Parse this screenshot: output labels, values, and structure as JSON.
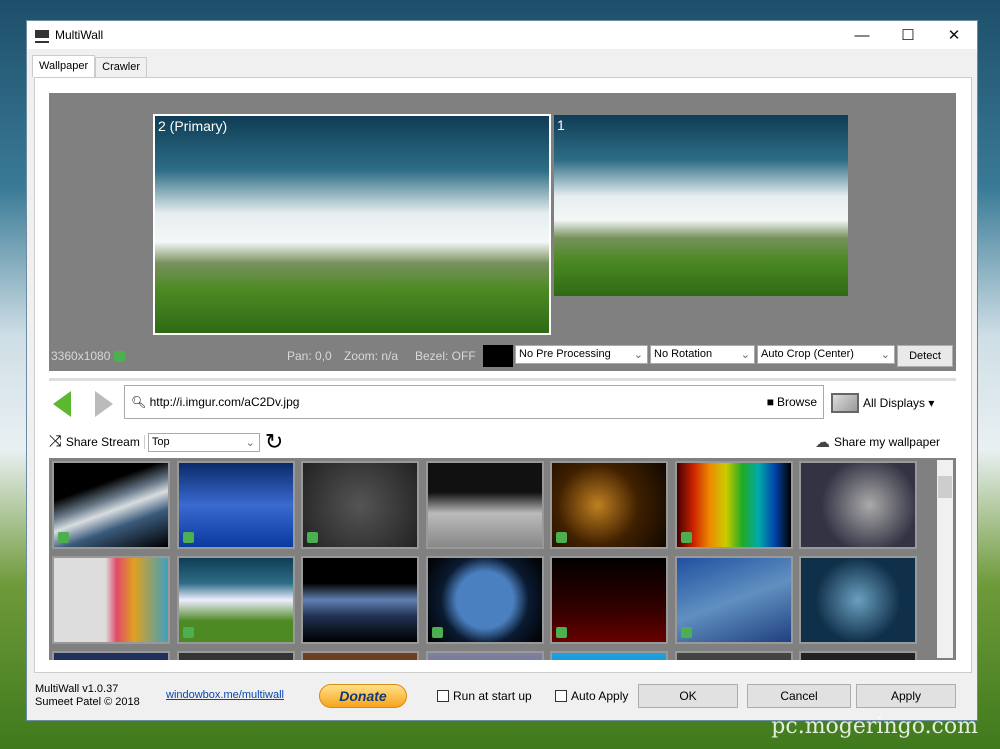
{
  "window": {
    "title": "MultiWall",
    "minimize": "—",
    "maximize": "☐",
    "close": "✕"
  },
  "tabs": [
    {
      "label": "Wallpaper",
      "active": true
    },
    {
      "label": "Crawler",
      "active": false
    }
  ],
  "preview": {
    "monitors": [
      {
        "label": "2 (Primary)"
      },
      {
        "label": "1"
      }
    ],
    "resolution": "3360x1080",
    "pan": "Pan: 0,0",
    "zoom": "Zoom: n/a",
    "bezel": "Bezel: OFF",
    "bg_color": "#000000",
    "pre_processing": "No Pre Processing",
    "rotation": "No Rotation",
    "crop": "Auto Crop (Center)",
    "detect": "Detect"
  },
  "url_bar": {
    "value": "http://i.imgur.com/aC2Dv.jpg",
    "browse": "Browse",
    "displays": "All Displays ▾"
  },
  "stream": {
    "share_stream": "Share Stream",
    "sort": "Top",
    "share_wallpaper": "Share my wallpaper"
  },
  "thumbnails": [
    {
      "bg": "linear-gradient(160deg,#000 30%,#6a7a8a 45%,#d8dde0 55%,#3a5a7a 70%,#000)",
      "liked": true
    },
    {
      "bg": "linear-gradient(180deg,#0a2a6a,#3a6ad0 50%,#0a3aa0)",
      "liked": true
    },
    {
      "bg": "radial-gradient(circle,#555,#222)",
      "liked": true
    },
    {
      "bg": "linear-gradient(180deg,#111 35%,#bbb 60%,#888)",
      "liked": false
    },
    {
      "bg": "radial-gradient(circle at 40% 50%,#c08020,#402000 50%,#100800)",
      "liked": true
    },
    {
      "bg": "linear-gradient(90deg,#400,#c20,#e80,#cc0,#2a2,#0aa,#04a,#000)",
      "liked": true
    },
    {
      "bg": "radial-gradient(circle at 60% 50%,#aaa,#334 60%)",
      "liked": false
    },
    {
      "bg": "linear-gradient(90deg,#ddd 45%,#e04a6a 55%,#e0a020 70%,#40a0c0)",
      "liked": false
    },
    {
      "bg": "linear-gradient(180deg,#0f3d55,#2d6d86 30%,#eef 50%,#4d8a24 75%)",
      "liked": true
    },
    {
      "bg": "linear-gradient(180deg,#000 30%,#6080b0 50%,#203050 70%,#000)",
      "liked": false
    },
    {
      "bg": "radial-gradient(circle,#4a80c0 40%,#0a1a30 62%,#000)",
      "liked": true
    },
    {
      "bg": "linear-gradient(180deg,#000,#300 60%,#600)",
      "liked": true
    },
    {
      "bg": "linear-gradient(160deg,#2050a0,#6090c0 50%,#204080)",
      "liked": true
    },
    {
      "bg": "radial-gradient(circle at 50% 50%,#6aa0c0,#10304a 60%)",
      "liked": false
    },
    {
      "bg": "linear-gradient(#203060,#101830)",
      "liked": false
    },
    {
      "bg": "linear-gradient(#333,#555)",
      "liked": false
    },
    {
      "bg": "linear-gradient(#704020,#302010)",
      "liked": false
    },
    {
      "bg": "linear-gradient(#8080a0,#404060)",
      "liked": false
    },
    {
      "bg": "linear-gradient(#20a0e0,#0060a0)",
      "liked": false
    },
    {
      "bg": "linear-gradient(#444,#222)",
      "liked": false
    },
    {
      "bg": "linear-gradient(#222,#111)",
      "liked": false
    }
  ],
  "footer": {
    "version": "MultiWall v1.0.37",
    "author": "Sumeet Patel © 2018",
    "link": "windowbox.me/multiwall",
    "donate": "Donate",
    "run_at_startup": "Run at start up",
    "auto_apply": "Auto Apply",
    "ok": "OK",
    "cancel": "Cancel",
    "apply": "Apply"
  },
  "watermark": "pc.mogeringo.com",
  "colors": {
    "accent_green": "#4caf50",
    "preview_bg": "#808080"
  }
}
